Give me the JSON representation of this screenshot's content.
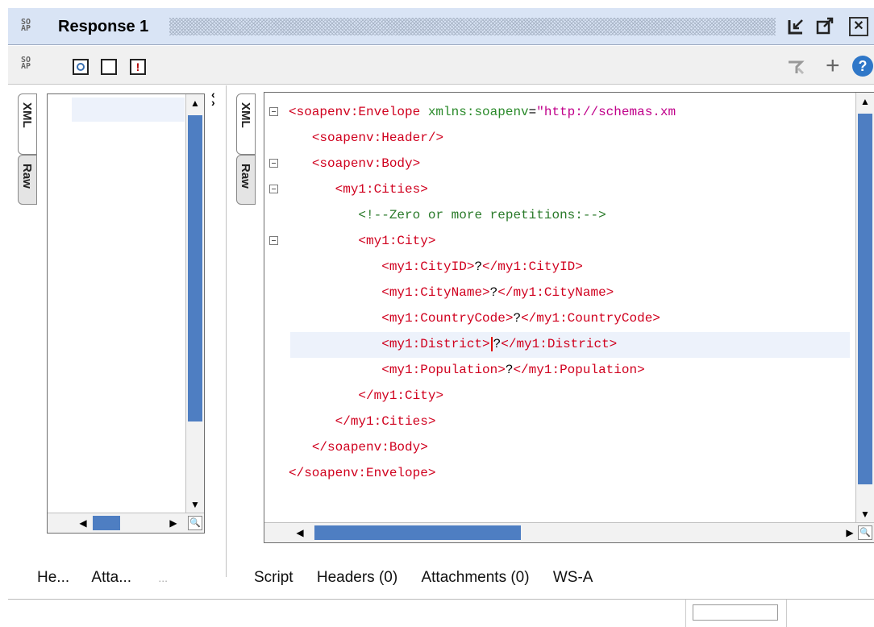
{
  "window": {
    "title": "Response 1",
    "logo_text": [
      "SO",
      "AP"
    ]
  },
  "toolbar": {
    "logo_text": [
      "SO",
      "AP"
    ],
    "error_glyph": "!",
    "add_glyph": "+",
    "help_glyph": "?"
  },
  "left_panel": {
    "tabs": [
      "XML",
      "Raw"
    ],
    "bottom_tabs": [
      "He...",
      "Atta...",
      "..."
    ]
  },
  "right_panel": {
    "tabs": [
      "XML",
      "Raw"
    ],
    "bottom_tabs": [
      "Script",
      "Headers (0)",
      "Attachments (0)",
      "WS-A"
    ],
    "xml_lines": [
      {
        "indent": "",
        "parts": [
          [
            "tag",
            "<soapenv:Envelope "
          ],
          [
            "attr",
            "xmlns:soapenv"
          ],
          [
            "txt",
            "="
          ],
          [
            "val",
            "\"http://schemas.xm"
          ]
        ]
      },
      {
        "indent": "   ",
        "parts": [
          [
            "tag",
            "<soapenv:Header/>"
          ]
        ]
      },
      {
        "indent": "   ",
        "parts": [
          [
            "tag",
            "<soapenv:Body>"
          ]
        ]
      },
      {
        "indent": "      ",
        "parts": [
          [
            "tag",
            "<my1:Cities>"
          ]
        ]
      },
      {
        "indent": "         ",
        "parts": [
          [
            "cmt",
            "<!--Zero or more repetitions:-->"
          ]
        ]
      },
      {
        "indent": "         ",
        "parts": [
          [
            "tag",
            "<my1:City>"
          ]
        ]
      },
      {
        "indent": "            ",
        "parts": [
          [
            "tag",
            "<my1:CityID>"
          ],
          [
            "txt",
            "?"
          ],
          [
            "tag",
            "</my1:CityID>"
          ]
        ]
      },
      {
        "indent": "            ",
        "parts": [
          [
            "tag",
            "<my1:CityName>"
          ],
          [
            "txt",
            "?"
          ],
          [
            "tag",
            "</my1:CityName>"
          ]
        ]
      },
      {
        "indent": "            ",
        "parts": [
          [
            "tag",
            "<my1:CountryCode>"
          ],
          [
            "txt",
            "?"
          ],
          [
            "tag",
            "</my1:CountryCode>"
          ]
        ]
      },
      {
        "indent": "            ",
        "parts": [
          [
            "tag",
            "<my1:District>"
          ],
          [
            "cursor",
            ""
          ],
          [
            "txt",
            "?"
          ],
          [
            "tag",
            "</my1:District>"
          ]
        ]
      },
      {
        "indent": "            ",
        "parts": [
          [
            "tag",
            "<my1:Population>"
          ],
          [
            "txt",
            "?"
          ],
          [
            "tag",
            "</my1:Population>"
          ]
        ]
      },
      {
        "indent": "         ",
        "parts": [
          [
            "tag",
            "</my1:City>"
          ]
        ]
      },
      {
        "indent": "      ",
        "parts": [
          [
            "tag",
            "</my1:Cities>"
          ]
        ]
      },
      {
        "indent": "   ",
        "parts": [
          [
            "tag",
            "</soapenv:Body>"
          ]
        ]
      },
      {
        "indent": "",
        "parts": [
          [
            "tag",
            "</soapenv:Envelope>"
          ]
        ]
      }
    ],
    "fold_lines": [
      0,
      2,
      3,
      5
    ],
    "highlighted_line": 9
  },
  "colors": {
    "tag": "#d0001e",
    "attribute": "#2a8a2a",
    "value": "#c0008a",
    "comment": "#2a7a2a",
    "scroll_thumb": "#4e7ec2",
    "title_bg": "#d9e4f5"
  }
}
